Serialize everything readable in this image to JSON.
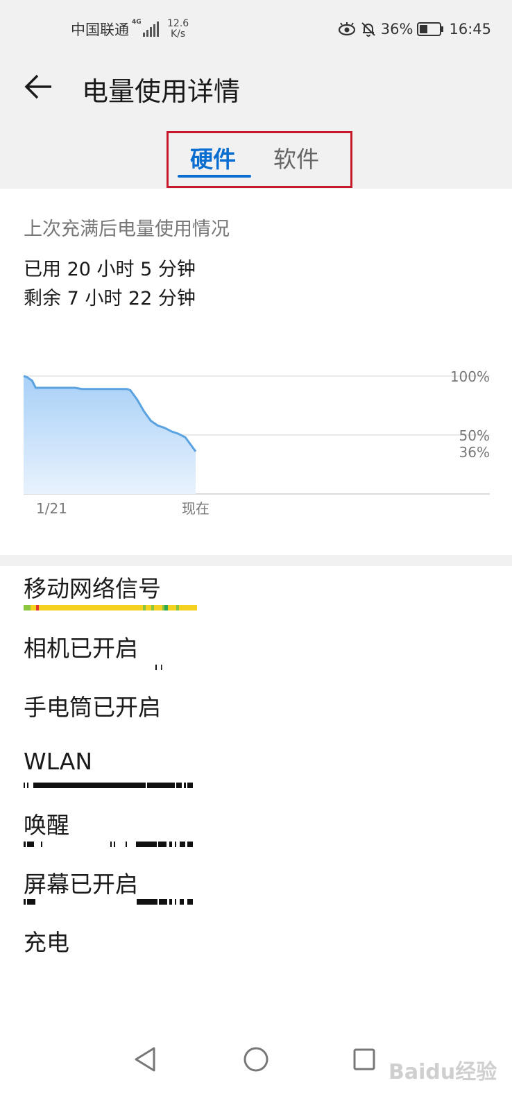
{
  "status_bar": {
    "carrier": "中国联通",
    "network": "4G",
    "speed_value": "12.6",
    "speed_unit": "K/s",
    "battery": "36%",
    "time": "16:45"
  },
  "header": {
    "title": "电量使用详情"
  },
  "tabs": [
    {
      "label": "硬件",
      "active": true
    },
    {
      "label": "软件",
      "active": false
    }
  ],
  "usage": {
    "subtitle": "上次充满后电量使用情况",
    "used": "已用 20 小时 5 分钟",
    "remaining": "剩余 7 小时 22 分钟"
  },
  "chart_data": {
    "type": "area",
    "y_tick_labels": [
      "100%",
      "50%",
      "36%"
    ],
    "x_tick_labels": [
      "1/21",
      "现在"
    ],
    "ylim": [
      0,
      100
    ],
    "x": [
      0,
      0.02,
      0.05,
      0.07,
      0.3,
      0.34,
      0.38,
      0.42,
      0.45,
      0.5,
      0.55,
      0.58,
      0.6,
      0.62,
      0.66,
      0.7,
      0.74,
      0.78,
      0.82,
      0.86,
      0.9,
      0.94,
      0.97,
      1.0
    ],
    "values": [
      100,
      99,
      96,
      90,
      90,
      89,
      89,
      89,
      89,
      89,
      89,
      89,
      89,
      88,
      80,
      70,
      62,
      58,
      56,
      53,
      51,
      48,
      42,
      36
    ],
    "grid": true,
    "color": "#5aa2e0"
  },
  "hardware_rows": [
    {
      "label": "移动网络信号",
      "bar": "signal"
    },
    {
      "label": "相机已开启",
      "bar": "camera"
    },
    {
      "label": "手电筒已开启",
      "bar": "none"
    },
    {
      "label": "WLAN",
      "bar": "wlan"
    },
    {
      "label": "唤醒",
      "bar": "wake"
    },
    {
      "label": "屏幕已开启",
      "bar": "screen"
    },
    {
      "label": "充电",
      "bar": "none"
    }
  ],
  "nav": {
    "back_icon": "triangle-back-icon",
    "home_icon": "circle-home-icon",
    "recents_icon": "square-recents-icon"
  },
  "watermark": "Baidu经验",
  "colors": {
    "accent": "#0a6ed1",
    "highlight_box": "#c61a2b",
    "signal_good": "#f4d21f",
    "signal_ok": "#8cc63e",
    "signal_bad": "#e0382b"
  }
}
